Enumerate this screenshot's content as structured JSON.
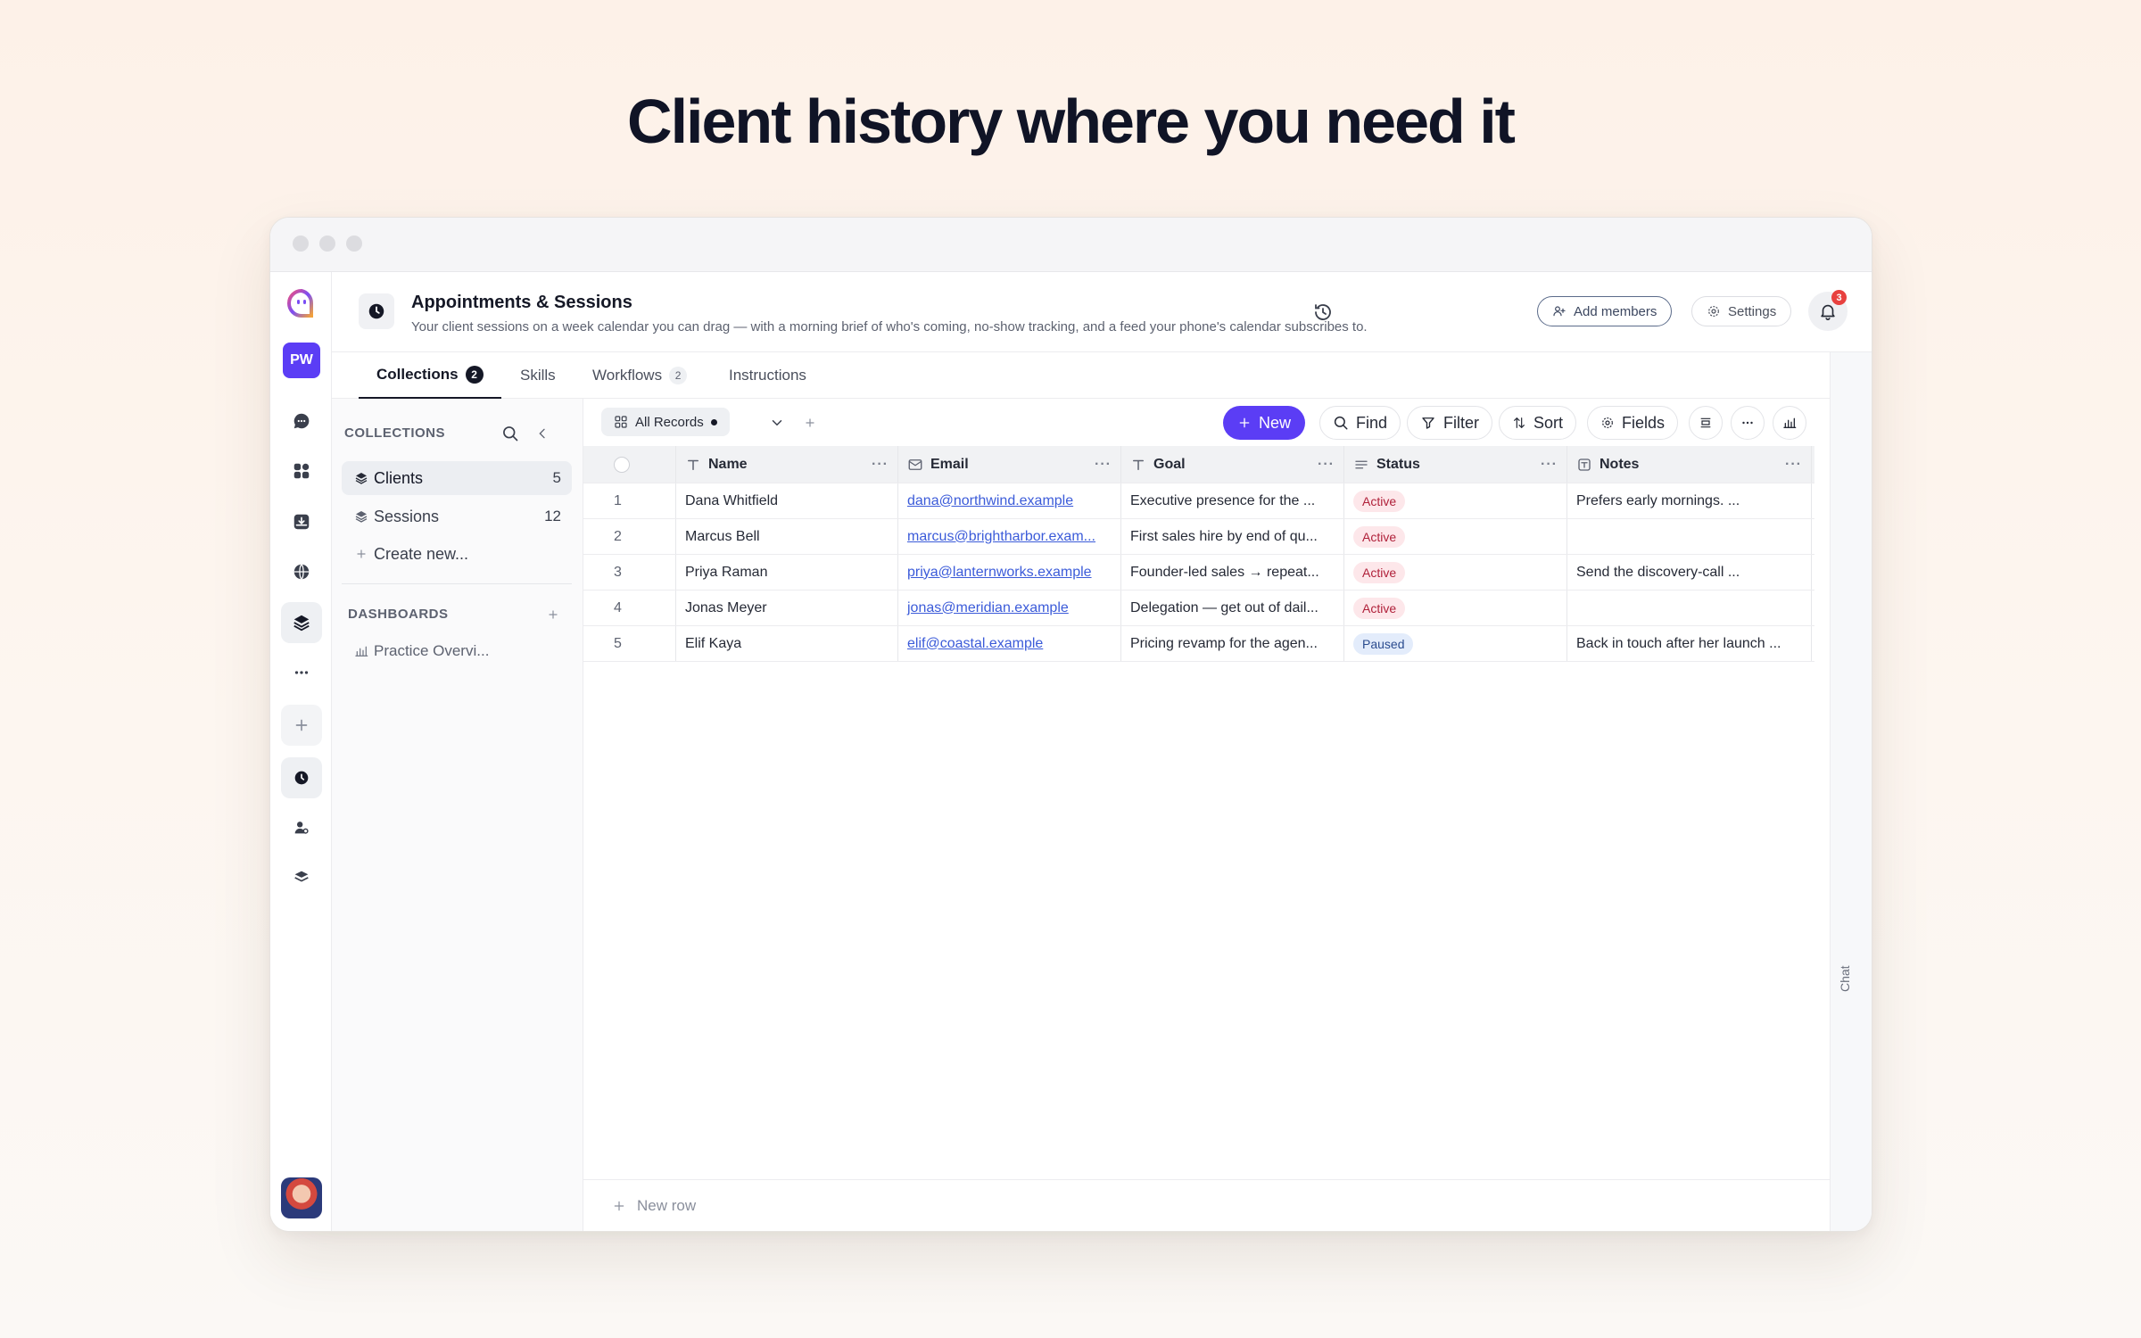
{
  "headline": "Client history where you need it",
  "rail": {
    "workspace_initials": "PW"
  },
  "header": {
    "title": "Appointments & Sessions",
    "description": "Your client sessions on a week calendar you can drag — with a morning brief of who's coming, no-show tracking, and a feed your phone's calendar subscribes to.",
    "add_members_label": "Add members",
    "settings_label": "Settings",
    "notification_count": "3"
  },
  "tabs": [
    {
      "label": "Collections",
      "count": "2"
    },
    {
      "label": "Skills"
    },
    {
      "label": "Workflows",
      "count": "2"
    },
    {
      "label": "Instructions"
    }
  ],
  "chat_label": "Chat",
  "collections_panel": {
    "collections_heading": "COLLECTIONS",
    "items": [
      {
        "label": "Clients",
        "count": "5"
      },
      {
        "label": "Sessions",
        "count": "12"
      }
    ],
    "create_new_label": "Create new...",
    "dashboards_heading": "DASHBOARDS",
    "dashboards": [
      {
        "label": "Practice Overvi..."
      }
    ]
  },
  "toolbar": {
    "view_label": "All Records",
    "new_label": "New",
    "find_label": "Find",
    "filter_label": "Filter",
    "sort_label": "Sort",
    "fields_label": "Fields"
  },
  "table": {
    "columns": [
      "Name",
      "Email",
      "Goal",
      "Status",
      "Notes"
    ],
    "rows": [
      {
        "num": "1",
        "name": "Dana Whitfield",
        "email": "dana@northwind.example",
        "goal": "Executive presence for the ...",
        "status": "Active",
        "notes": "Prefers early mornings. ..."
      },
      {
        "num": "2",
        "name": "Marcus Bell",
        "email": "marcus@brightharbor.exam...",
        "goal": "First sales hire by end of qu...",
        "status": "Active",
        "notes": ""
      },
      {
        "num": "3",
        "name": "Priya Raman",
        "email": "priya@lanternworks.example",
        "goal": "Founder-led sales → repeat...",
        "status": "Active",
        "notes": "Send the discovery-call ..."
      },
      {
        "num": "4",
        "name": "Jonas Meyer",
        "email": "jonas@meridian.example",
        "goal": "Delegation — get out of dail...",
        "status": "Active",
        "notes": ""
      },
      {
        "num": "5",
        "name": "Elif Kaya",
        "email": "elif@coastal.example",
        "goal": "Pricing revamp for the agen...",
        "status": "Paused",
        "notes": "Back in touch after her launch ..."
      }
    ],
    "new_row_label": "New row"
  },
  "colors": {
    "accent": "#5b3df5",
    "active_badge_bg": "#fde7ea",
    "active_badge_text": "#b0213a",
    "paused_badge_bg": "#e3ecfb",
    "paused_badge_text": "#2b4c8f",
    "notification": "#e8413f"
  }
}
